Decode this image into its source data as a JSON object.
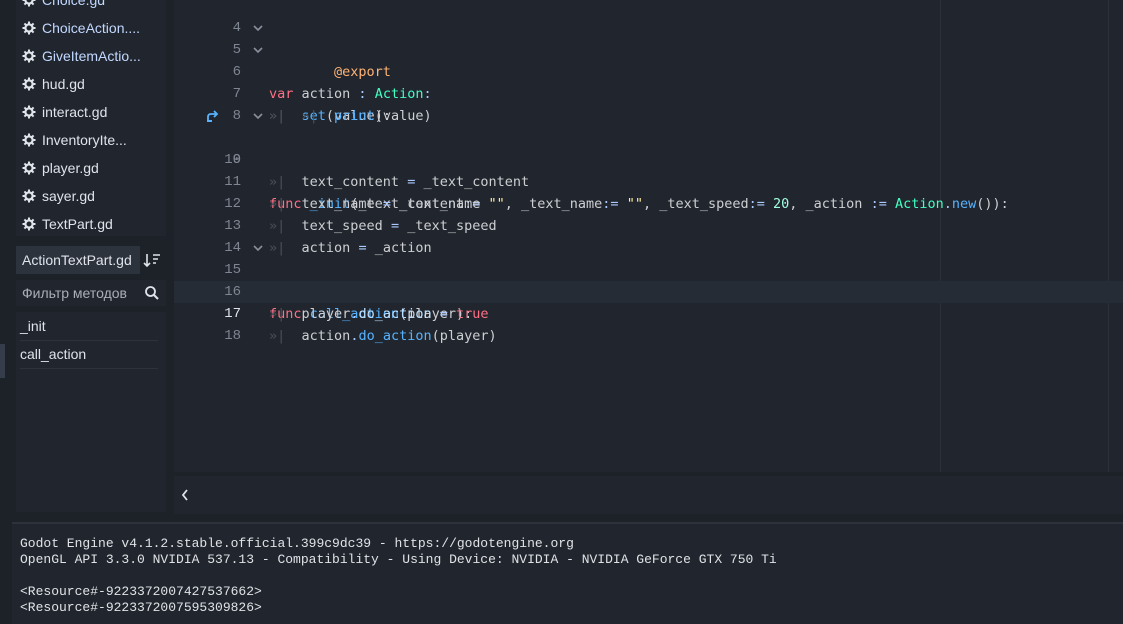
{
  "scripts": [
    {
      "name": "Choice.gd",
      "link": true
    },
    {
      "name": "ChoiceAction....",
      "link": true
    },
    {
      "name": "GiveItemActio...",
      "link": true
    },
    {
      "name": "hud.gd",
      "link": false
    },
    {
      "name": "interact.gd",
      "link": false
    },
    {
      "name": "InventoryIte...",
      "link": false
    },
    {
      "name": "player.gd",
      "link": false
    },
    {
      "name": "sayer.gd",
      "link": false
    },
    {
      "name": "TextPart.gd",
      "link": false
    }
  ],
  "current_file": "ActionTextPart.gd",
  "filter": {
    "placeholder": "Фильтр методов",
    "value": ""
  },
  "methods": [
    "_init",
    "call_action"
  ],
  "editor": {
    "lines": [
      {
        "n": "4"
      },
      {
        "n": "5"
      },
      {
        "n": "6"
      },
      {
        "n": "7"
      },
      {
        "n": "8"
      },
      {
        "n": "9"
      },
      {
        "n": "10"
      },
      {
        "n": "11"
      },
      {
        "n": "12"
      },
      {
        "n": "13"
      },
      {
        "n": "14"
      },
      {
        "n": "15"
      },
      {
        "n": "16"
      },
      {
        "n": "17"
      },
      {
        "n": "18"
      }
    ],
    "tokens": {
      "l4": [
        "@export"
      ],
      "l5": [
        "var",
        " action ",
        ": ",
        "Action",
        ":"
      ],
      "l6": [
        "set",
        "(value):"
      ],
      "l7": [
        "print",
        "(value)"
      ],
      "l9": [
        "func",
        " ",
        "_init",
        "(_text_content",
        ":= ",
        "\"\"",
        ", _text_name",
        ":= ",
        "\"\"",
        ", _text_speed",
        ":= ",
        "20",
        ", _action ",
        ":= ",
        "Action",
        ".",
        "new",
        "()):"
      ],
      "l10": [
        "text_content ",
        "= ",
        "_text_content"
      ],
      "l11": [
        "text_name ",
        "= ",
        "_text_name"
      ],
      "l12": [
        "text_speed ",
        "= ",
        "_text_speed"
      ],
      "l13": [
        "action ",
        "= ",
        "_action"
      ],
      "l15": [
        "func",
        " ",
        "call_action",
        "(player):"
      ],
      "l16": [
        "player",
        ".",
        "do_action",
        " ",
        "= ",
        "true"
      ],
      "l17": [
        "action",
        ".",
        "do_action",
        "(player)"
      ]
    }
  },
  "output_lines": [
    "Godot Engine v4.1.2.stable.official.399c9dc39 - https://godotengine.org",
    "OpenGL API 3.3.0 NVIDIA 537.13 - Compatibility - Using Device: NVIDIA - NVIDIA GeForce GTX 750 Ti",
    "",
    "<Resource#-9223372007427537662>",
    "<Resource#-9223372007595309826>"
  ],
  "icons": {
    "script": "gear-icon",
    "sort": "sort-icon",
    "search": "search-icon",
    "fold": "chevron-down-icon",
    "override": "override-arrow-icon",
    "collapse": "chevron-left-icon"
  },
  "colors": {
    "keyword": "#ff7085",
    "function": "#57b3ff",
    "type": "#42ffc2",
    "string": "#ffeda1",
    "number": "#a1ffe0",
    "annotation": "#ffb373",
    "link_text": "#c2d8ff"
  }
}
